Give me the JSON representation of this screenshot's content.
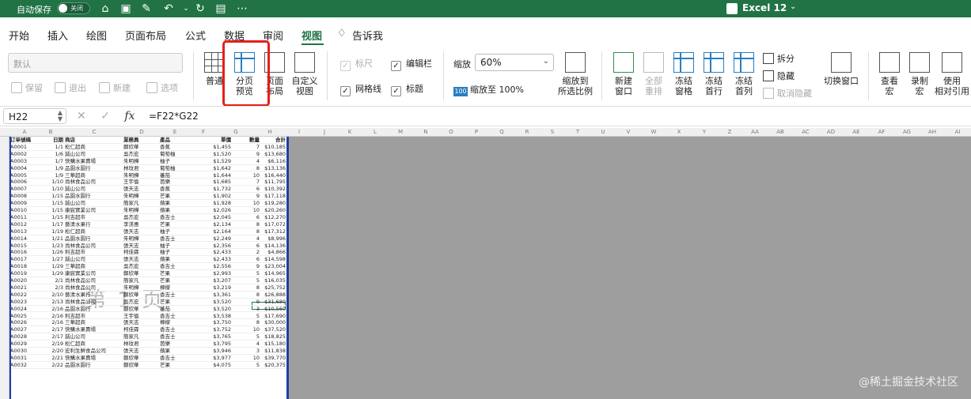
{
  "titlebar": {
    "autosave_label": "自动保存",
    "toggle_label": "关闭",
    "app_title": "Excel 12",
    "chevron": "⌄",
    "quick_icons": [
      "home-icon",
      "save-icon",
      "edit-save-icon",
      "undo-icon",
      "redo-icon",
      "more-icon"
    ]
  },
  "tabs": [
    "开始",
    "插入",
    "绘图",
    "页面布局",
    "公式",
    "数据",
    "审阅",
    "视图",
    "告诉我"
  ],
  "active_tab": "视图",
  "ribbon": {
    "style_default": "默认",
    "sheet_view_buttons": [
      "保留",
      "退出",
      "新建",
      "选项"
    ],
    "workbook_views": [
      {
        "label": "普通",
        "disabled": false
      },
      {
        "label": "分页\n预览",
        "disabled": false
      },
      {
        "label": "页面\n布局",
        "disabled": false
      },
      {
        "label": "自定义\n视图",
        "disabled": false
      }
    ],
    "show_checks": [
      {
        "label": "标尺",
        "checked": true,
        "disabled": true
      },
      {
        "label": "编辑栏",
        "checked": true,
        "disabled": false
      },
      {
        "label": "网格线",
        "checked": true,
        "disabled": false
      },
      {
        "label": "标题",
        "checked": true,
        "disabled": false
      }
    ],
    "zoom_label": "缩放",
    "zoom_value": "60%",
    "zoom_100_label": "缩放至 100%",
    "zoom_to_selection": "缩放到\n所选比例",
    "window_buttons": [
      {
        "label": "新建\n窗口",
        "disabled": false
      },
      {
        "label": "全部\n重排",
        "disabled": true
      },
      {
        "label": "冻结\n窗格",
        "disabled": false
      },
      {
        "label": "冻结\n首行",
        "disabled": false
      },
      {
        "label": "冻结\n首列",
        "disabled": false
      }
    ],
    "split_label": "拆分",
    "hide_label": "隐藏",
    "unhide_label": "取消隐藏",
    "switch_window_label": "切换窗口",
    "macro_buttons": [
      "查看\n宏",
      "录制\n宏",
      "使用\n相对引用"
    ]
  },
  "formula_bar": {
    "name_box": "H22",
    "formula": "=F22*G22",
    "cancel_glyph": "✕",
    "enter_glyph": "✓",
    "fx_glyph": "fx"
  },
  "sheet": {
    "columns": [
      "A",
      "B",
      "C",
      "D",
      "E",
      "F",
      "G",
      "H",
      "I",
      "J",
      "K",
      "L",
      "M",
      "N",
      "O",
      "P",
      "Q",
      "R",
      "S",
      "T",
      "U",
      "V",
      "W",
      "X",
      "Y",
      "Z",
      "AA",
      "AB",
      "AC",
      "AD",
      "AE",
      "AF",
      "AG",
      "AH",
      "AI"
    ],
    "headers": [
      "订单號碼",
      "日期",
      "商店",
      "業務員",
      "產品",
      "單價",
      "數量",
      "合計"
    ],
    "rows": [
      [
        "A0001",
        "1/1",
        "松仁超商",
        "鄭欣華",
        "香蕉",
        "$1,455",
        "7",
        "$10,185"
      ],
      [
        "A0002",
        "1/6",
        "誠山公司",
        "吳杰宏",
        "葡萄柚",
        "$1,520",
        "9",
        "$13,680"
      ],
      [
        "A0003",
        "1/7",
        "快購水果賣場",
        "朱明樺",
        "柚子",
        "$1,529",
        "4",
        "$6,116"
      ],
      [
        "A0004",
        "1/9",
        "品園水園行",
        "林玟君",
        "葡萄柚",
        "$1,642",
        "8",
        "$13,136"
      ],
      [
        "A0005",
        "1/9",
        "三華超商",
        "朱明樺",
        "蕃茄",
        "$1,644",
        "10",
        "$16,440"
      ],
      [
        "A0006",
        "1/10",
        "尚林食品公司",
        "王宇倫",
        "芭樂",
        "$1,685",
        "7",
        "$11,795"
      ],
      [
        "A0007",
        "1/10",
        "誠山公司",
        "張天志",
        "香蕉",
        "$1,732",
        "6",
        "$10,392"
      ],
      [
        "A0008",
        "1/15",
        "品園水園行",
        "朱明樺",
        "芒果",
        "$1,902",
        "9",
        "$17,118"
      ],
      [
        "A0009",
        "1/15",
        "誠山公司",
        "簡家凡",
        "蘋果",
        "$1,928",
        "10",
        "$19,280"
      ],
      [
        "A0010",
        "1/15",
        "康宸實業公司",
        "朱明樺",
        "蘋果",
        "$2,026",
        "10",
        "$20,260"
      ],
      [
        "A0011",
        "1/15",
        "利吉超市",
        "吳杰宏",
        "香吉士",
        "$2,045",
        "6",
        "$12,270"
      ],
      [
        "A0012",
        "1/17",
        "藝清水果行",
        "李渼惠",
        "芒果",
        "$2,134",
        "8",
        "$17,072"
      ],
      [
        "A0013",
        "1/19",
        "松仁超商",
        "張天志",
        "柚子",
        "$2,164",
        "8",
        "$17,312"
      ],
      [
        "A0014",
        "1/21",
        "品園水園行",
        "朱明樺",
        "香吉士",
        "$2,249",
        "4",
        "$8,996"
      ],
      [
        "A0015",
        "1/23",
        "尚林食品公司",
        "張天志",
        "柚子",
        "$2,356",
        "6",
        "$14,136"
      ],
      [
        "A0016",
        "1/26",
        "利吉超市",
        "柯佳霖",
        "柚子",
        "$2,433",
        "2",
        "$4,866"
      ],
      [
        "A0017",
        "1/27",
        "誠山公司",
        "張天志",
        "蘋果",
        "$2,433",
        "6",
        "$14,598"
      ],
      [
        "A0018",
        "1/29",
        "三華超商",
        "吳杰宏",
        "香吉士",
        "$2,556",
        "9",
        "$23,004"
      ],
      [
        "A0019",
        "1/29",
        "康宸實業公司",
        "鄭欣華",
        "芒果",
        "$2,993",
        "5",
        "$14,965"
      ],
      [
        "A0020",
        "2/1",
        "尚林食品公司",
        "簡家凡",
        "芒果",
        "$3,207",
        "5",
        "$16,035"
      ],
      [
        "A0021",
        "2/3",
        "尚林食品公司",
        "朱明樺",
        "檸檬",
        "$3,219",
        "8",
        "$25,752"
      ],
      [
        "A0022",
        "2/10",
        "藝清水果行",
        "鄭欣華",
        "香吉士",
        "$3,361",
        "8",
        "$26,888"
      ],
      [
        "A0023",
        "2/13",
        "尚林食品公司",
        "吳杰宏",
        "芒果",
        "$3,520",
        "9",
        "$31,680"
      ],
      [
        "A0024",
        "2/16",
        "品園水園行",
        "鄭欣華",
        "蕃茄",
        "$3,520",
        "3",
        "$10,560"
      ],
      [
        "A0025",
        "2/16",
        "利吉超市",
        "王宇倫",
        "香吉士",
        "$3,538",
        "5",
        "$17,690"
      ],
      [
        "A0026",
        "2/16",
        "三華超商",
        "張天志",
        "檸檬",
        "$3,750",
        "8",
        "$30,000"
      ],
      [
        "A0027",
        "2/17",
        "快購水果賣場",
        "柯佳霖",
        "香吉士",
        "$3,752",
        "10",
        "$37,520"
      ],
      [
        "A0028",
        "2/17",
        "誠山公司",
        "簡家凡",
        "香吉士",
        "$3,765",
        "5",
        "$18,825"
      ],
      [
        "A0029",
        "2/19",
        "松仁超商",
        "林玟君",
        "芭樂",
        "$3,795",
        "4",
        "$15,180"
      ],
      [
        "A0030",
        "2/20",
        "宏利生鮮食品公司",
        "張天志",
        "蘋果",
        "$3,946",
        "3",
        "$11,838"
      ],
      [
        "A0031",
        "2/21",
        "快購水果賣場",
        "鄭欣華",
        "香吉士",
        "$3,977",
        "10",
        "$39,770"
      ],
      [
        "A0032",
        "2/22",
        "品園水園行",
        "鄭欣華",
        "芒果",
        "$4,075",
        "5",
        "$20,375"
      ]
    ],
    "watermark": "第 1 页",
    "credit": "@稀土掘金技术社区"
  }
}
